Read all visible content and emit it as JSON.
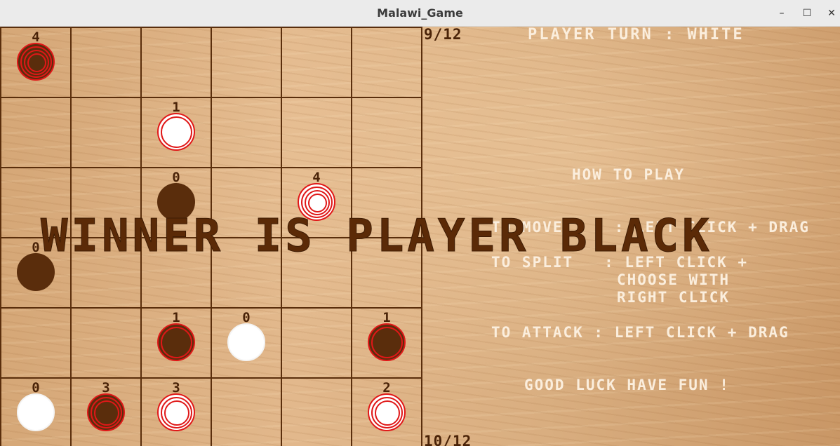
{
  "window": {
    "title": "Malawi_Game",
    "controls": {
      "minimize": "–",
      "maximize": "☐",
      "close": "✕"
    }
  },
  "game": {
    "page_top": "9/12",
    "page_bottom": "10/12",
    "turn_text": "PLAYER TURN : WHITE",
    "winner_text": "WINNER IS PLAYER BLACK",
    "how_to_play": {
      "title": "HOW TO PLAY",
      "move": "TO MOVE     : LEFT CLICK + DRAG",
      "split_1": "TO SPLIT   : LEFT CLICK +",
      "split_2": "CHOOSE WITH",
      "split_3": "RIGHT CLICK",
      "attack": "TO ATTACK : LEFT CLICK + DRAG",
      "good_luck": "GOOD LUCK HAVE FUN !"
    },
    "board": {
      "rows": 6,
      "cols": 6,
      "pieces": [
        {
          "row": 0,
          "col": 0,
          "color": "black",
          "count": "4",
          "stack": 4
        },
        {
          "row": 1,
          "col": 2,
          "color": "white",
          "count": "1",
          "stack": 2
        },
        {
          "row": 2,
          "col": 2,
          "color": "black",
          "count": "0",
          "stack": 1
        },
        {
          "row": 2,
          "col": 4,
          "color": "white",
          "count": "4",
          "stack": 4
        },
        {
          "row": 3,
          "col": 0,
          "color": "black",
          "count": "0",
          "stack": 1
        },
        {
          "row": 4,
          "col": 2,
          "color": "black",
          "count": "1",
          "stack": 2
        },
        {
          "row": 4,
          "col": 3,
          "color": "white",
          "count": "0",
          "stack": 1
        },
        {
          "row": 4,
          "col": 5,
          "color": "black",
          "count": "1",
          "stack": 2
        },
        {
          "row": 5,
          "col": 0,
          "color": "white",
          "count": "0",
          "stack": 1
        },
        {
          "row": 5,
          "col": 1,
          "color": "black",
          "count": "3",
          "stack": 3
        },
        {
          "row": 5,
          "col": 2,
          "color": "white",
          "count": "3",
          "stack": 3
        },
        {
          "row": 5,
          "col": 5,
          "color": "white",
          "count": "2",
          "stack": 3
        }
      ]
    },
    "colors": {
      "black_piece": "#5a2d0c",
      "white_piece": "#ffffff",
      "piece_outline": "#e01818",
      "grid": "#5a2e0c",
      "winner": "#5b2a07",
      "info_text": "#fbeedd"
    }
  }
}
